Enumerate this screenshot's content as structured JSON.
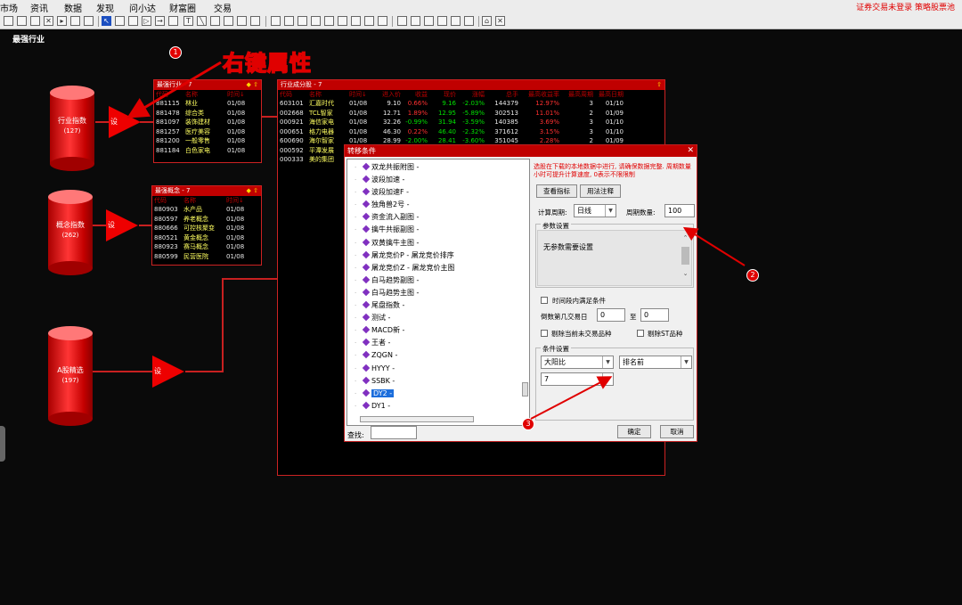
{
  "menu": [
    "市场",
    "资讯",
    "数据",
    "发现",
    "问小达",
    "财富圈",
    "交易"
  ],
  "status_right": "证券交易未登录  策略股票池",
  "page_label": "最强行业",
  "annotation": {
    "title": "右键属性",
    "n1": "1",
    "n2": "2",
    "n3": "3"
  },
  "cylinders": [
    {
      "label": "行业指数",
      "count": "(127)"
    },
    {
      "label": "概念指数",
      "count": "(262)"
    },
    {
      "label": "A股精选",
      "count": "(197)"
    }
  ],
  "tri_label": "设",
  "panel_industry": {
    "title": "最强行业 - 7",
    "headers": [
      "代码",
      "名称",
      "时间↓"
    ],
    "rows": [
      [
        "881115",
        "林业",
        "01/08"
      ],
      [
        "881478",
        "综合类",
        "01/08"
      ],
      [
        "881097",
        "装饰建材",
        "01/08"
      ],
      [
        "881257",
        "医疗美容",
        "01/08"
      ],
      [
        "881200",
        "一般零售",
        "01/08"
      ],
      [
        "881184",
        "白色家电",
        "01/08"
      ]
    ]
  },
  "panel_concept": {
    "title": "最强概念 - 7",
    "headers": [
      "代码",
      "名称",
      "时间↓"
    ],
    "rows": [
      [
        "880903",
        "水产品",
        "01/08"
      ],
      [
        "880597",
        "养老概念",
        "01/08"
      ],
      [
        "880666",
        "可控核聚变",
        "01/08"
      ],
      [
        "880521",
        "黄金概念",
        "01/08"
      ],
      [
        "880923",
        "赛马概念",
        "01/08"
      ],
      [
        "880599",
        "民营医院",
        "01/08"
      ]
    ]
  },
  "panel_stocks": {
    "title": "行业成分股 - 7",
    "headers": [
      "代码",
      "名称",
      "时间↓",
      "进入价",
      "收益",
      "现价",
      "涨幅",
      "总手",
      "最高收益率",
      "最高周期",
      "最高日期"
    ],
    "rows": [
      [
        "603101",
        "汇嘉时代",
        "01/08",
        "9.10",
        "0.66%",
        "9.16",
        "-2.03%",
        "144379",
        "12.97%",
        "3",
        "01/10"
      ],
      [
        "002668",
        "TCL智家",
        "01/08",
        "12.71",
        "1.89%",
        "12.95",
        "-5.89%",
        "302513",
        "11.01%",
        "2",
        "01/09"
      ],
      [
        "000921",
        "海信家电",
        "01/08",
        "32.26",
        "-0.99%",
        "31.94",
        "-3.59%",
        "140385",
        "3.69%",
        "3",
        "01/10"
      ],
      [
        "000651",
        "格力电器",
        "01/08",
        "46.30",
        "0.22%",
        "46.40",
        "-2.32%",
        "371612",
        "3.15%",
        "3",
        "01/10"
      ],
      [
        "600690",
        "海尔智家",
        "01/08",
        "28.99",
        "-2.00%",
        "28.41",
        "-3.60%",
        "351045",
        "2.28%",
        "2",
        "01/09"
      ],
      [
        "000592",
        "平潭发展",
        "",
        "",
        "",
        "",
        "",
        "",
        "",
        "",
        ""
      ],
      [
        "000333",
        "美的集团",
        "",
        "",
        "",
        "",
        "",
        "",
        "",
        "",
        ""
      ]
    ]
  },
  "dialog": {
    "title": "转移条件",
    "tree": [
      "双龙共振附图 -",
      "波段加速 -",
      "波段加速F -",
      "独角兽2号 -",
      "资金流入副图 -",
      "擒牛共振副图 -",
      "双黄擒牛主图 -",
      "屠龙竞价P - 屠龙竞价排序",
      "屠龙竞价Z - 屠龙竞价主图",
      "白马趋势副图 -",
      "白马趋势主图 -",
      "尾盘指数 -",
      "测试 -",
      "MACD新 -",
      "王者 -",
      "ZQGN -",
      "HYYY -",
      "SSBK -",
      "DY2 -",
      "DY1 -"
    ],
    "selected_index": 18,
    "find_label": "查找:",
    "find_value": "",
    "notice": "选股在下载的本地数据中进行, 请确保数据完整. 周期数量小时可提升计算速度, 0表示不限限制",
    "btn_view": "查看指标",
    "btn_usage": "用法注释",
    "period_label": "计算周期:",
    "period_value": "日线",
    "count_label": "周期数量:",
    "count_value": "100",
    "param_group": "参数设置",
    "param_text": "无参数需要设置",
    "chk_time": "时间段内满足条件",
    "recent_label": "倒数第几交易日",
    "recent_from": "0",
    "recent_to_label": "至",
    "recent_to": "0",
    "chk_remove_untraded": "剔除当前未交易品种",
    "chk_remove_st": "剔除ST品种",
    "cond_group": "条件设置",
    "cond_select": "大阳比",
    "cond_rank": "排名前",
    "cond_value": "7",
    "btn_ok": "确定",
    "btn_cancel": "取消"
  },
  "colors": {
    "red": "#e00000",
    "up": "#ff3030",
    "down": "#00e000",
    "yellow": "#ffff60"
  }
}
